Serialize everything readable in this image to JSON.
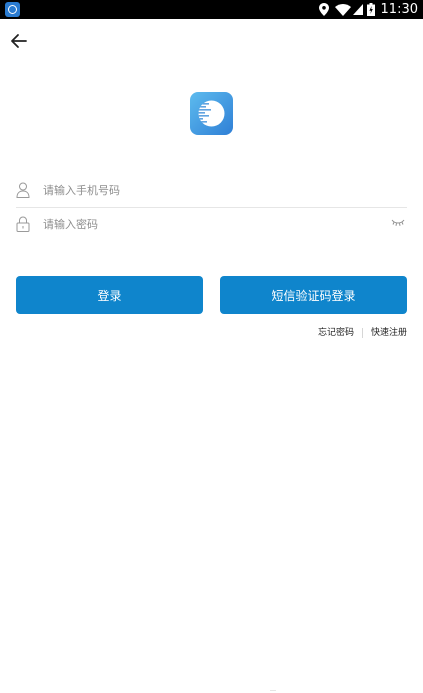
{
  "status_bar": {
    "time": "11:30",
    "icons": [
      "app-icon",
      "location-icon",
      "wifi-icon",
      "signal-icon",
      "battery-icon"
    ]
  },
  "navigation": {
    "back_icon": "arrow-left-icon"
  },
  "logo": {
    "icon": "app-logo-icon"
  },
  "form": {
    "phone_placeholder": "请输入手机号码",
    "phone_icon": "user-icon",
    "password_placeholder": "请输入密码",
    "password_icon": "lock-icon",
    "visibility_icon": "eye-closed-icon"
  },
  "buttons": {
    "login_label": "登录",
    "sms_login_label": "短信验证码登录"
  },
  "links": {
    "forgot_password": "忘记密码",
    "quick_register": "快速注册"
  },
  "colors": {
    "primary": "#0f85cc",
    "status_bar": "#000000",
    "logo_gradient_start": "#5dbbee",
    "logo_gradient_end": "#2f7fd6"
  }
}
